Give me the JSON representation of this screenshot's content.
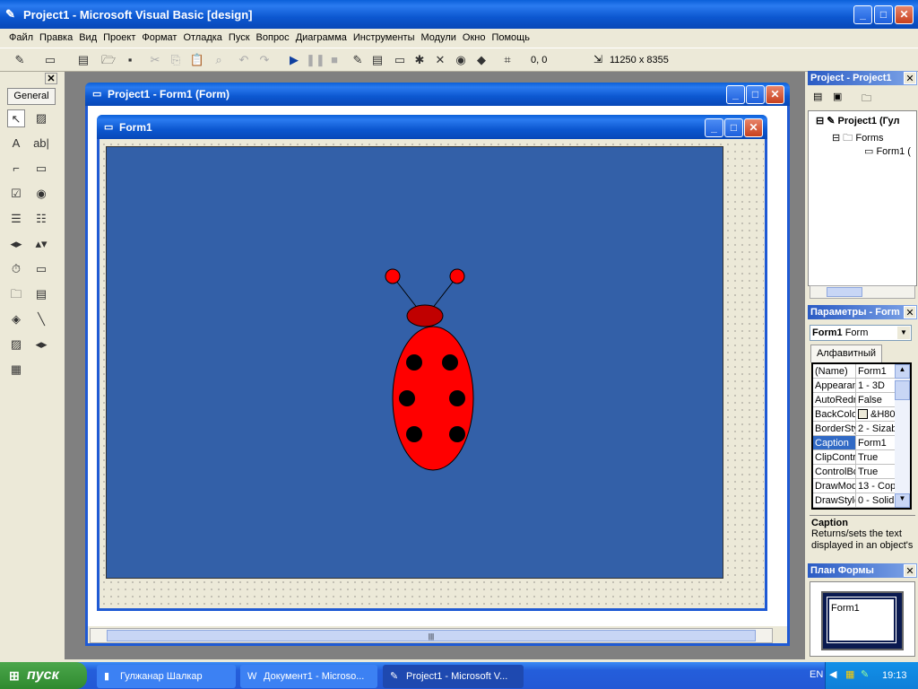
{
  "window": {
    "title": "Project1 - Microsoft Visual Basic [design]"
  },
  "menu": [
    "Файл",
    "Правка",
    "Вид",
    "Проект",
    "Формат",
    "Отладка",
    "Пуск",
    "Вопрос",
    "Диаграмма",
    "Инструменты",
    "Модули",
    "Окно",
    "Помощь"
  ],
  "toolbar": {
    "position": "0, 0",
    "size": "11250 x 8355"
  },
  "toolbox": {
    "tab": "General"
  },
  "designer": {
    "title": "Project1 - Form1 (Form)",
    "form_title": "Form1",
    "form_backcolor": "#3360a8"
  },
  "project": {
    "title": "Project - Project1",
    "root": "Project1 (Гул",
    "folder": "Forms",
    "form": "Form1 ("
  },
  "properties": {
    "title": "Параметры - Form",
    "object": "Form1",
    "object_type": "Form",
    "tab": "Алфавитный",
    "rows": [
      [
        "(Name)",
        "Form1"
      ],
      [
        "Appearan",
        "1 - 3D"
      ],
      [
        "AutoRedr",
        "False"
      ],
      [
        "BackColor",
        "&H80"
      ],
      [
        "BorderSty",
        "2 - Sizab"
      ],
      [
        "Caption",
        "Form1"
      ],
      [
        "ClipContro",
        "True"
      ],
      [
        "ControlBo",
        "True"
      ],
      [
        "DrawMod",
        "13 - Cop"
      ],
      [
        "DrawStyle",
        "0 - Solid"
      ]
    ],
    "selected": "Caption",
    "desc_title": "Caption",
    "desc_text": "Returns/sets the text displayed in an object's"
  },
  "layout": {
    "title": "План Формы",
    "form_label": "Form1"
  },
  "taskbar": {
    "start": "пуск",
    "items": [
      "Гулжанар Шалкар",
      "Документ1 - Microso...",
      "Project1 - Microsoft V..."
    ],
    "lang": "EN",
    "clock": "19:13"
  }
}
